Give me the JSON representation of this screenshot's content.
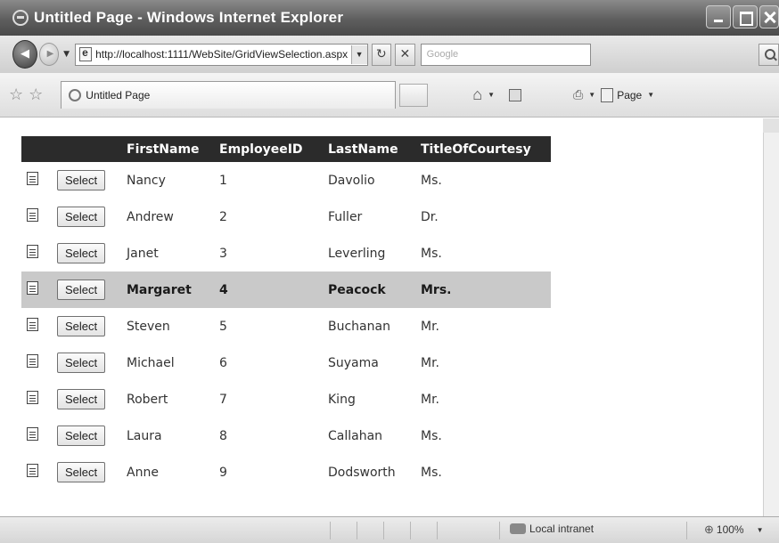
{
  "window": {
    "title": "Untitled Page - Windows Internet Explorer"
  },
  "toolbar": {
    "url": "http://localhost:1111/WebSite/GridViewSelection.aspx",
    "search_placeholder": "Google",
    "tab_label": "Untitled Page",
    "page_menu_label": "Page"
  },
  "grid": {
    "headers": [
      "FirstName",
      "EmployeeID",
      "LastName",
      "TitleOfCourtesy"
    ],
    "select_label": "Select",
    "selected_index": 3,
    "rows": [
      {
        "first": "Nancy",
        "id": "1",
        "last": "Davolio",
        "title": "Ms."
      },
      {
        "first": "Andrew",
        "id": "2",
        "last": "Fuller",
        "title": "Dr."
      },
      {
        "first": "Janet",
        "id": "3",
        "last": "Leverling",
        "title": "Ms."
      },
      {
        "first": "Margaret",
        "id": "4",
        "last": "Peacock",
        "title": "Mrs."
      },
      {
        "first": "Steven",
        "id": "5",
        "last": "Buchanan",
        "title": "Mr."
      },
      {
        "first": "Michael",
        "id": "6",
        "last": "Suyama",
        "title": "Mr."
      },
      {
        "first": "Robert",
        "id": "7",
        "last": "King",
        "title": "Mr."
      },
      {
        "first": "Laura",
        "id": "8",
        "last": "Callahan",
        "title": "Ms."
      },
      {
        "first": "Anne",
        "id": "9",
        "last": "Dodsworth",
        "title": "Ms."
      }
    ]
  },
  "status": {
    "zone": "Local intranet",
    "zoom": "100%"
  },
  "icons": {
    "back": "back-arrow-icon",
    "forward": "forward-arrow-icon",
    "page": "page-icon",
    "refresh": "refresh-icon",
    "stop": "stop-icon",
    "search": "search-icon",
    "favorites": "star-icon",
    "add_favorites": "add-favorites-icon",
    "home": "home-icon",
    "feeds": "feeds-icon",
    "print": "print-icon",
    "row": "document-icon",
    "zone": "network-icon",
    "zoom": "zoom-icon"
  }
}
